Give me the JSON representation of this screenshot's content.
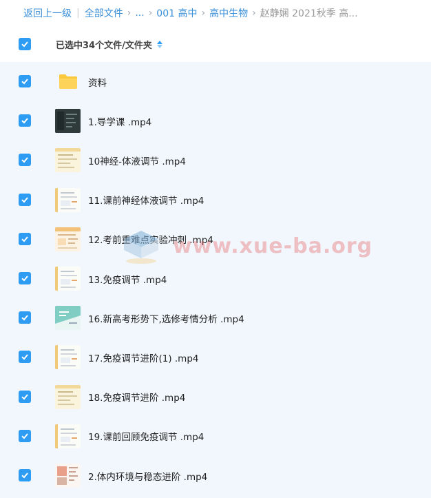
{
  "breadcrumb": {
    "back": "返回上一级",
    "all_files": "全部文件",
    "ellipsis": "...",
    "path": [
      "001 高中",
      "高中生物"
    ],
    "current": "赵静娴 2021秋季 高..."
  },
  "header": {
    "selection_text": "已选中34个文件/文件夹"
  },
  "files": [
    {
      "name": "资料",
      "type": "folder"
    },
    {
      "name": "1.导学课 .mp4",
      "type": "video",
      "thumb": "dark"
    },
    {
      "name": "10神经-体液调节 .mp4",
      "type": "video",
      "thumb": "doc-yellow"
    },
    {
      "name": "11.课前神经体液调节 .mp4",
      "type": "video",
      "thumb": "doc-white"
    },
    {
      "name": "12.考前重难点实验冲刺 .mp4",
      "type": "video",
      "thumb": "doc-orange"
    },
    {
      "name": "13.免疫调节 .mp4",
      "type": "video",
      "thumb": "doc-white"
    },
    {
      "name": "16.新高考形势下,选修考情分析 .mp4",
      "type": "video",
      "thumb": "teal"
    },
    {
      "name": "17.免疫调节进阶(1) .mp4",
      "type": "video",
      "thumb": "doc-white"
    },
    {
      "name": "18.免疫调节进阶 .mp4",
      "type": "video",
      "thumb": "doc-yellow"
    },
    {
      "name": "19.课前回顾免疫调节 .mp4",
      "type": "video",
      "thumb": "doc-white"
    },
    {
      "name": "2.体内环境与稳态进阶 .mp4",
      "type": "video",
      "thumb": "doc-red"
    }
  ],
  "watermark": "www.xue-ba.org",
  "colors": {
    "accent": "#2d9cf2",
    "link": "#3a8fd9",
    "list_background": "#f1f7fd",
    "folder": "#fcc83e"
  }
}
